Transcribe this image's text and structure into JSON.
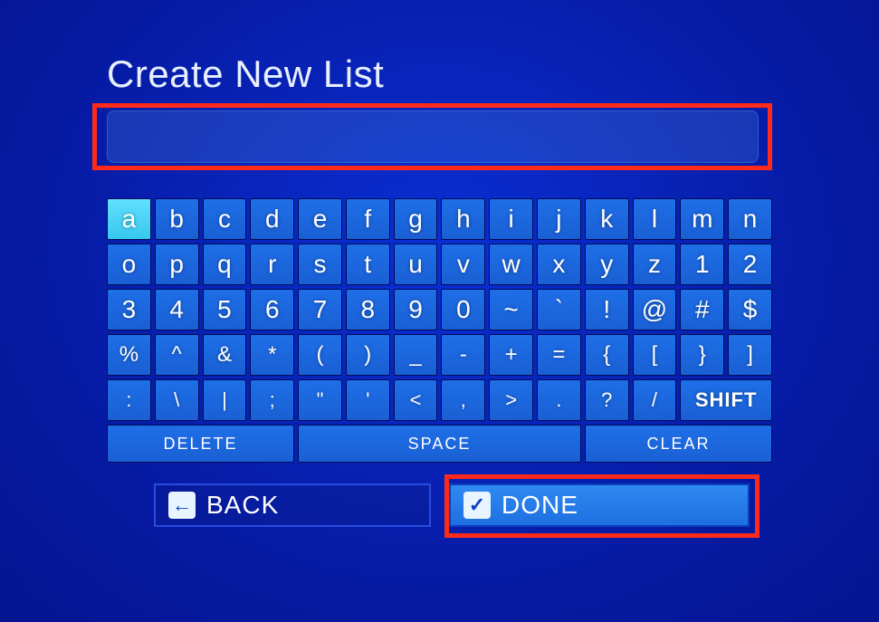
{
  "title": "Create New List",
  "input": {
    "value": ""
  },
  "keyboard": {
    "selected_key": "a",
    "rows": [
      [
        "a",
        "b",
        "c",
        "d",
        "e",
        "f",
        "g",
        "h",
        "i",
        "j",
        "k",
        "l",
        "m",
        "n"
      ],
      [
        "o",
        "p",
        "q",
        "r",
        "s",
        "t",
        "u",
        "v",
        "w",
        "x",
        "y",
        "z",
        "1",
        "2"
      ],
      [
        "3",
        "4",
        "5",
        "6",
        "7",
        "8",
        "9",
        "0",
        "~",
        "`",
        "!",
        "@",
        "#",
        "$"
      ],
      [
        "%",
        "^",
        "&",
        "*",
        "(",
        ")",
        "_",
        "-",
        "+",
        "=",
        "{",
        "[",
        "}",
        "]"
      ],
      [
        ":",
        "\\",
        "|",
        ";",
        "\"",
        "'",
        "<",
        ",",
        ">",
        ".",
        "?",
        "/",
        "SHIFT"
      ]
    ],
    "actions": {
      "delete": "DELETE",
      "space": "SPACE",
      "clear": "CLEAR"
    }
  },
  "buttons": {
    "back": {
      "icon": "←",
      "label": "BACK"
    },
    "done": {
      "icon": "✓",
      "label": "DONE"
    }
  }
}
